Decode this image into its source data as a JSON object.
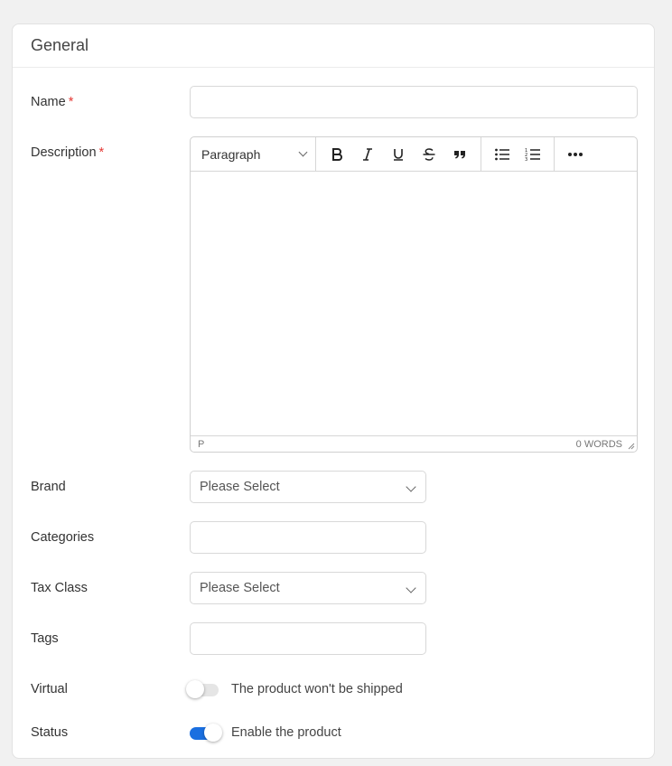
{
  "section": {
    "title": "General"
  },
  "fields": {
    "name": {
      "label": "Name",
      "required_mark": "*",
      "value": ""
    },
    "description": {
      "label": "Description",
      "required_mark": "*",
      "format_value": "Paragraph",
      "status_path": "P",
      "word_count": "0 WORDS"
    },
    "brand": {
      "label": "Brand",
      "selected": "Please Select"
    },
    "categories": {
      "label": "Categories",
      "value": ""
    },
    "tax_class": {
      "label": "Tax Class",
      "selected": "Please Select"
    },
    "tags": {
      "label": "Tags",
      "value": ""
    },
    "virtual": {
      "label": "Virtual",
      "toggle_text": "The product won't be shipped",
      "checked": false
    },
    "status": {
      "label": "Status",
      "toggle_text": "Enable the product",
      "checked": true
    }
  },
  "colors": {
    "accent": "#1a6fe0",
    "required": "#e53935"
  }
}
